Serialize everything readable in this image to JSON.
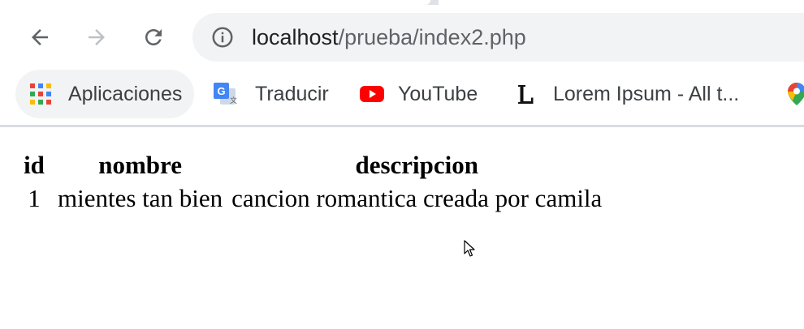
{
  "browser": {
    "url_host": "localhost",
    "url_path": "/prueba/index2.php"
  },
  "bookmarks": [
    {
      "label": "Aplicaciones",
      "icon": "apps-grid-icon"
    },
    {
      "label": "Traducir",
      "icon": "google-translate-icon"
    },
    {
      "label": "YouTube",
      "icon": "youtube-icon"
    },
    {
      "label": "Lorem Ipsum - All t...",
      "icon": "lorem-ipsum-icon"
    },
    {
      "label": "",
      "icon": "google-maps-icon"
    }
  ],
  "table": {
    "headers": [
      "id",
      "nombre",
      "descripcion"
    ],
    "rows": [
      [
        "1",
        "mientes tan bien",
        "cancion romantica creada por camila"
      ]
    ]
  },
  "colors": {
    "omnibox_bg": "#f1f3f4",
    "youtube_red": "#ff0000",
    "translate_blue": "#4285f4"
  }
}
